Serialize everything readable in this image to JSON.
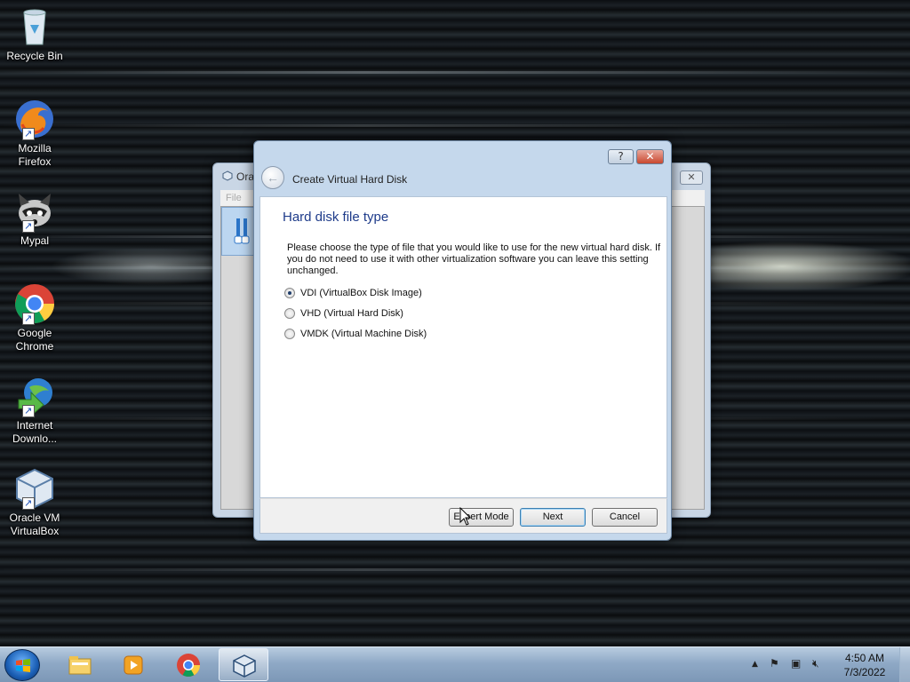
{
  "desktop": {
    "icons": [
      {
        "label": "Recycle Bin",
        "icon": "recycle-bin-icon"
      },
      {
        "label": "Mozilla Firefox",
        "icon": "firefox-icon"
      },
      {
        "label": "Mypal",
        "icon": "mypal-icon"
      },
      {
        "label": "Google Chrome",
        "icon": "chrome-icon"
      },
      {
        "label": "Internet Downlo...",
        "icon": "internet-download-manager-icon"
      },
      {
        "label": "Oracle VM VirtualBox",
        "icon": "virtualbox-icon"
      }
    ]
  },
  "background_window": {
    "title": "Ora",
    "menu_file": "File"
  },
  "dialog": {
    "title": "Create Virtual Hard Disk",
    "help_label": "?",
    "close_label": "✕",
    "heading": "Hard disk file type",
    "description": "Please choose the type of file that you would like to use for the new virtual hard disk. If you do not need to use it with other virtualization software you can leave this setting unchanged.",
    "options": [
      {
        "label": "VDI (VirtualBox Disk Image)",
        "checked": true
      },
      {
        "label": "VHD (Virtual Hard Disk)",
        "checked": false
      },
      {
        "label": "VMDK (Virtual Machine Disk)",
        "checked": false
      }
    ],
    "buttons": {
      "expert": "Expert Mode",
      "next": "Next",
      "cancel": "Cancel"
    }
  },
  "taskbar": {
    "items": [
      "windows-explorer-icon",
      "media-player-icon",
      "chrome-icon",
      "virtualbox-icon"
    ],
    "clock_time": "4:50 AM",
    "clock_date": "7/3/2022"
  },
  "colors": {
    "heading": "#1e3b8a",
    "dialog_frame": "#c5d8ec",
    "taskbar": "#8fa9c6"
  }
}
